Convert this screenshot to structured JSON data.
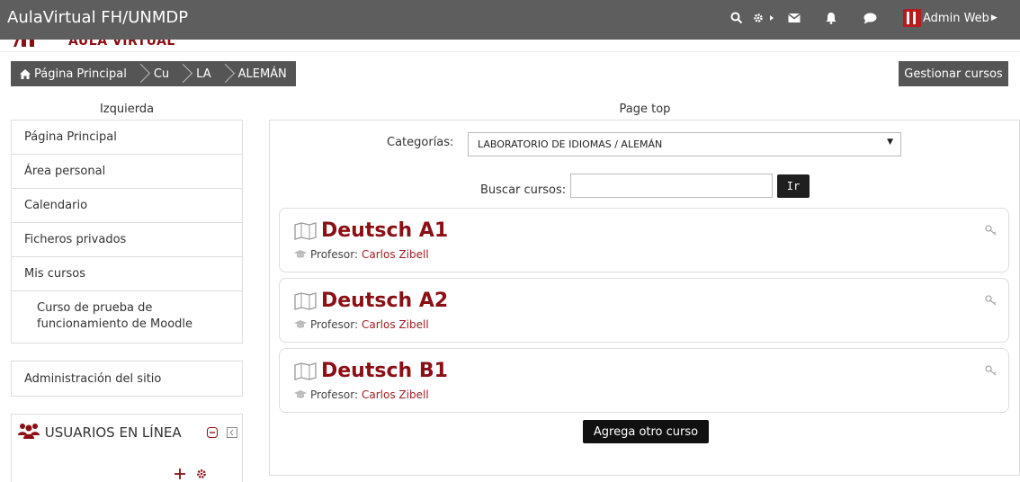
{
  "app": {
    "title": "AulaVirtual FH/UNMDP"
  },
  "user": {
    "name": "Admin Web"
  },
  "logo_text": "AULA VIRTUAL",
  "breadcrumb": {
    "items": [
      "Página Principal",
      "Cu",
      "LA",
      "ALEMÁN"
    ]
  },
  "manage_button": "Gestionar cursos",
  "regions": {
    "left": "Izquierda",
    "top": "Page top"
  },
  "navigation": {
    "items": [
      "Página Principal",
      "Área personal",
      "Calendario",
      "Ficheros privados",
      "Mis cursos"
    ],
    "sub_item": "Curso de prueba de funcionamiento de Moodle"
  },
  "admin_block": "Administración del sitio",
  "online_block": {
    "title": "USUARIOS EN LÍNEA"
  },
  "category": {
    "label": "Categorías:",
    "selected": "LABORATORIO DE IDIOMAS / ALEMÁN"
  },
  "search": {
    "label": "Buscar cursos:",
    "value": "",
    "button": "Ir"
  },
  "courses": [
    {
      "name": "Deutsch A1",
      "teacher_label": "Profesor:",
      "teacher": "Carlos Zibell"
    },
    {
      "name": "Deutsch A2",
      "teacher_label": "Profesor:",
      "teacher": "Carlos Zibell"
    },
    {
      "name": "Deutsch B1",
      "teacher_label": "Profesor:",
      "teacher": "Carlos Zibell"
    }
  ],
  "add_course_button": "Agrega otro curso",
  "colors": {
    "topbar": "#5e5e5e",
    "brand": "#8b0f14",
    "link": "#a31d24",
    "dark_button": "#1f1f1f"
  }
}
